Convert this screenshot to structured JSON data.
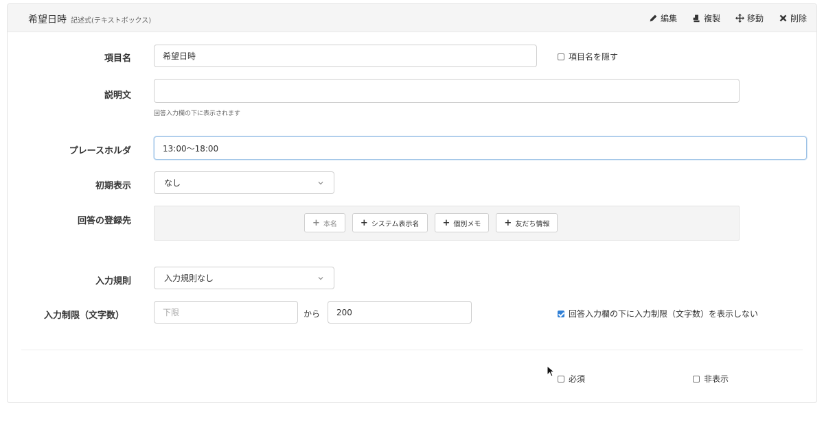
{
  "header": {
    "title": "希望日時",
    "subtitle": "記述式(テキストボックス)",
    "actions": [
      {
        "label": "編集",
        "icon": "pencil-icon"
      },
      {
        "label": "複製",
        "icon": "copy-icon"
      },
      {
        "label": "移動",
        "icon": "move-icon"
      },
      {
        "label": "削除",
        "icon": "close-icon"
      }
    ]
  },
  "fields": {
    "item_name": {
      "label": "項目名",
      "value": "希望日時",
      "hide_label": "項目名を隠す",
      "hide_checked": false
    },
    "description": {
      "label": "説明文",
      "value": "",
      "help": "回答入力欄の下に表示されます"
    },
    "placeholder": {
      "label": "プレースホルダ",
      "value": "13:00〜18:00"
    },
    "initial_display": {
      "label": "初期表示",
      "selected": "なし"
    },
    "registration": {
      "label": "回答の登録先",
      "buttons": [
        {
          "label": "本名",
          "enabled": false
        },
        {
          "label": "システム表示名",
          "enabled": true
        },
        {
          "label": "個別メモ",
          "enabled": true
        },
        {
          "label": "友だち情報",
          "enabled": true
        }
      ]
    },
    "input_rule": {
      "label": "入力規則",
      "selected": "入力規則なし"
    },
    "char_limit": {
      "label": "入力制限（文字数）",
      "min_placeholder": "下限",
      "min_value": "",
      "from_label": "から",
      "max_value": "200",
      "hide_limit_label": "回答入力欄の下に入力制限（文字数）を表示しない",
      "hide_limit_checked": true
    }
  },
  "footer": {
    "required_label": "必須",
    "required_checked": false,
    "hidden_label": "非表示",
    "hidden_checked": false
  },
  "colors": {
    "accent": "#2f7fd6",
    "header_bg": "#f5f5f5",
    "focus_border": "#9ec3e6"
  }
}
